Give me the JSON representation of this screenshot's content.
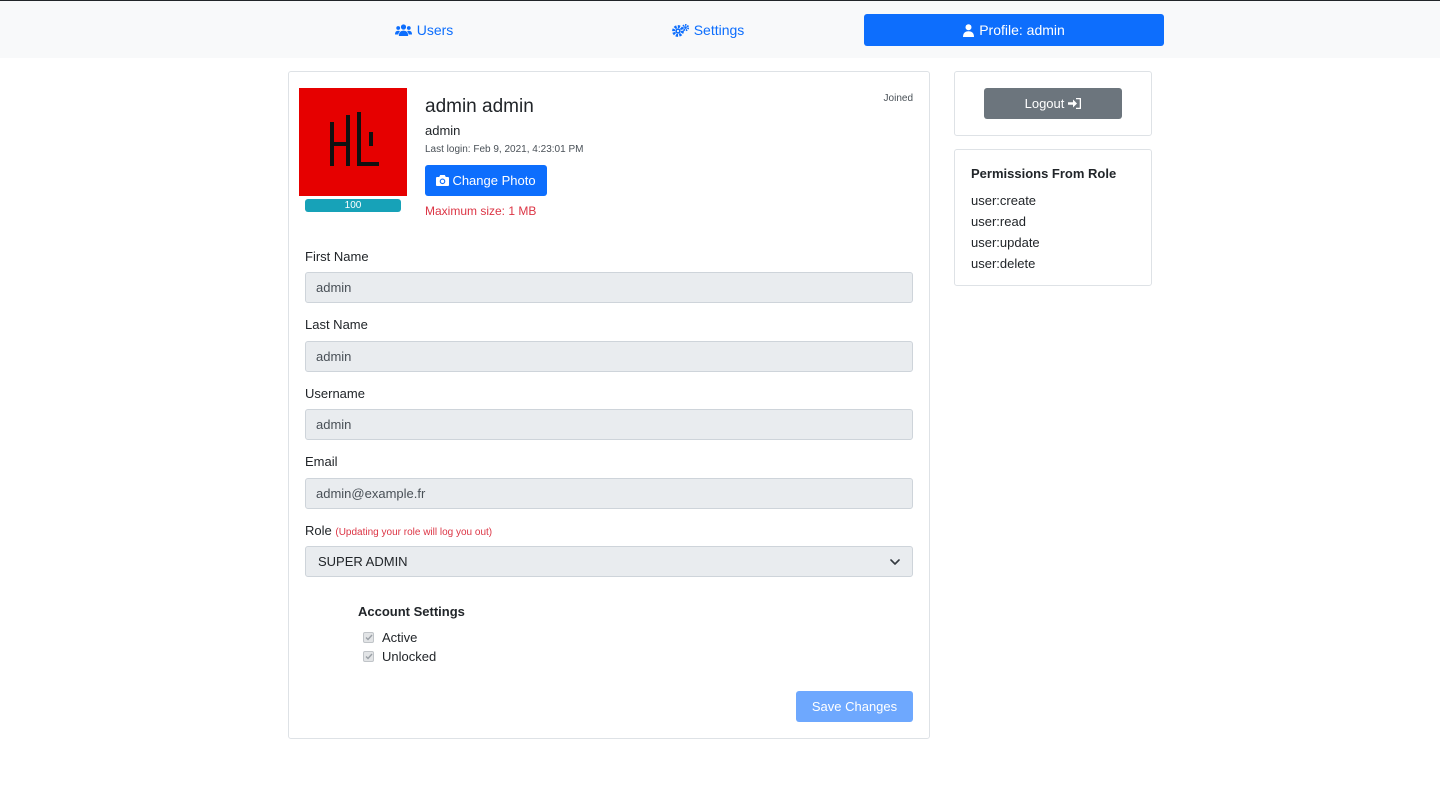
{
  "nav": {
    "users_label": "Users",
    "settings_label": "Settings",
    "profile_label": "Profile: admin",
    "users_icon": "users-icon",
    "settings_icon": "cogs-icon",
    "profile_icon": "user-icon"
  },
  "profile": {
    "avatar_logo_text": "HL",
    "avatar_bg_color": "#e60000",
    "upload_progress_label": "100",
    "upload_progress_percent": 100,
    "full_name": "admin admin",
    "username": "admin",
    "last_login": "Last login: Feb 9, 2021, 4:23:01 PM",
    "change_photo_label": "Change Photo",
    "max_size_note": "Maximum size: 1 MB",
    "joined_label": "Joined"
  },
  "form": {
    "first_name_label": "First Name",
    "first_name_value": "admin",
    "last_name_label": "Last Name",
    "last_name_value": "admin",
    "username_label": "Username",
    "username_value": "admin",
    "email_label": "Email",
    "email_value": "admin@example.fr",
    "role_label": "Role",
    "role_note": "(Updating your role will log you out)",
    "role_value": "SUPER ADMIN",
    "account_settings_title": "Account Settings",
    "active_label": "Active",
    "active_checked": true,
    "unlocked_label": "Unlocked",
    "unlocked_checked": true,
    "save_label": "Save Changes"
  },
  "sidebar": {
    "logout_label": "Logout",
    "permissions_title": "Permissions From Role",
    "permissions": [
      "user:create",
      "user:read",
      "user:update",
      "user:delete"
    ]
  },
  "colors": {
    "primary": "#0d6efd",
    "primary_light": "#6ea8fe",
    "secondary": "#6c757d",
    "danger": "#dc3545",
    "info": "#17a2b8"
  }
}
